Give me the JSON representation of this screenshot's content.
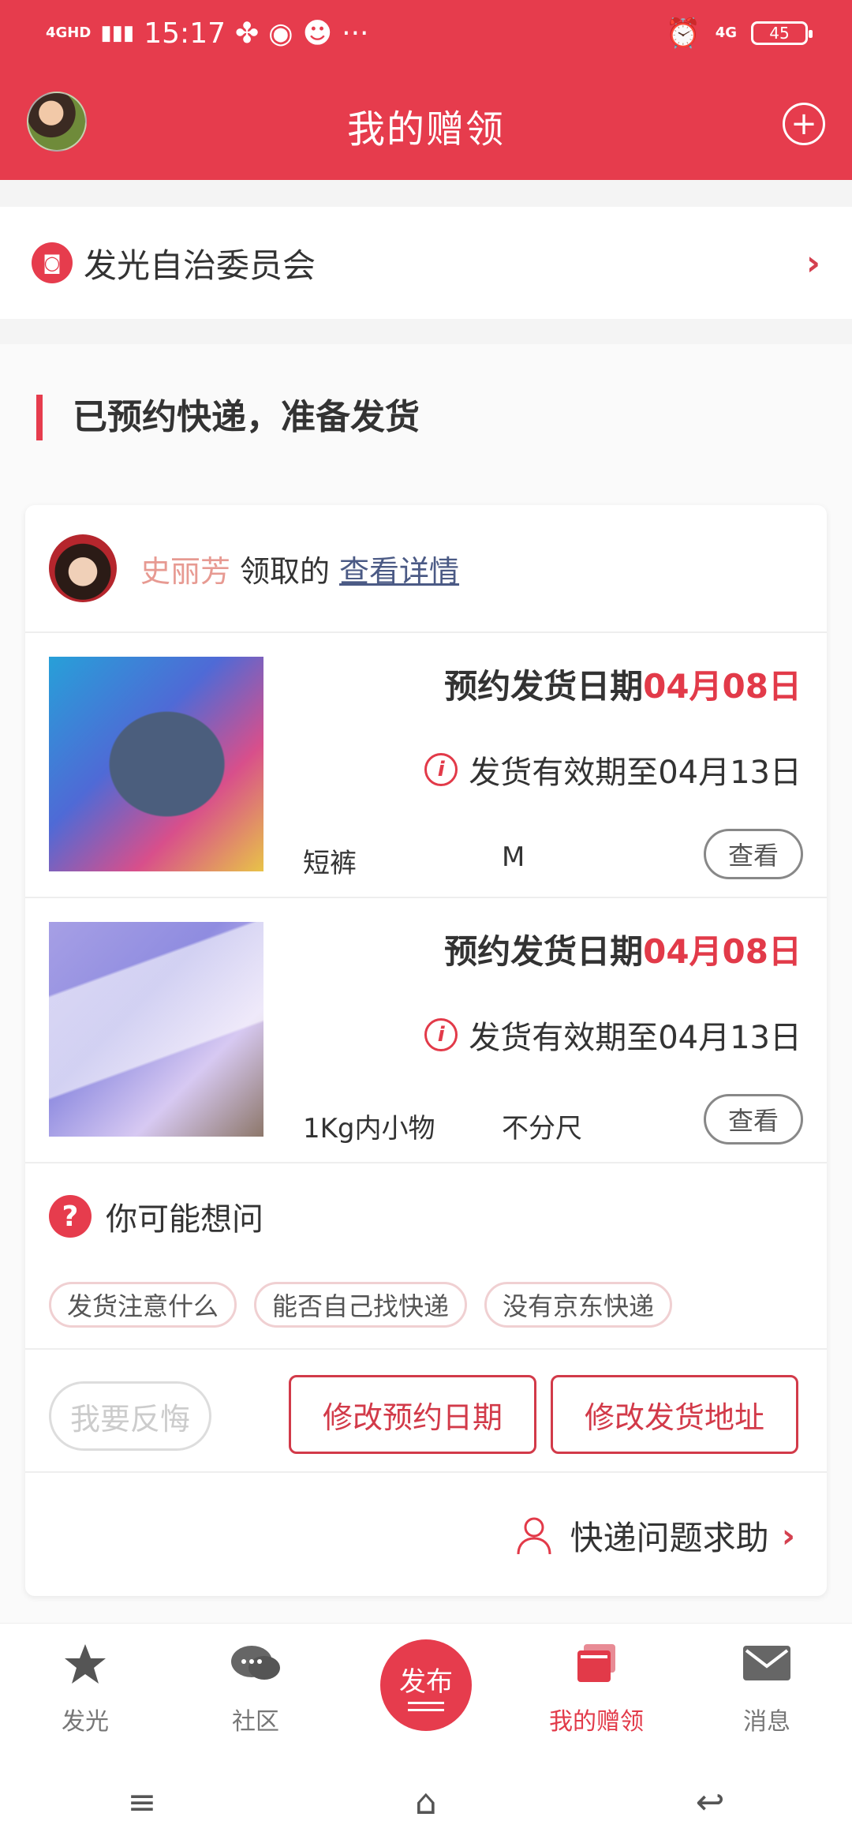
{
  "status_bar": {
    "network": "4GHD",
    "time": "15:17",
    "right_network": "4G",
    "battery": "45"
  },
  "header": {
    "title": "我的赠领"
  },
  "committee": {
    "label": "发光自治委员会"
  },
  "section": {
    "title": "已预约快递，准备发货"
  },
  "card": {
    "user_name": "史丽芳",
    "take_text": "领取的",
    "detail_link": "查看详情",
    "items": [
      {
        "date_label": "预约发货日期",
        "date_value": "04月08日",
        "valid_text": "发货有效期至04月13日",
        "name": "短裤",
        "size": "M",
        "view_label": "查看"
      },
      {
        "date_label": "预约发货日期",
        "date_value": "04月08日",
        "valid_text": "发货有效期至04月13日",
        "name": "1Kg内小物",
        "size": "不分尺",
        "view_label": "查看"
      }
    ],
    "faq_title": "你可能想问",
    "faq_tags": [
      "发货注意什么",
      "能否自己找快递",
      "没有京东快递"
    ],
    "regret_label": "我要反悔",
    "modify_date_label": "修改预约日期",
    "modify_address_label": "修改发货地址",
    "help_label": "快递问题求助"
  },
  "tabbar": {
    "tabs": [
      {
        "label": "发光",
        "icon": "star-icon"
      },
      {
        "label": "社区",
        "icon": "chat-bubble-icon"
      },
      {
        "label": "发布",
        "icon": "publish-icon"
      },
      {
        "label": "我的赠领",
        "icon": "gift-stack-icon",
        "active": true
      },
      {
        "label": "消息",
        "icon": "mail-icon"
      }
    ]
  },
  "colors": {
    "brand_red": "#e63c4d",
    "date_red": "#e23a49",
    "user_name": "#e79a92",
    "link": "#4b5a85"
  }
}
